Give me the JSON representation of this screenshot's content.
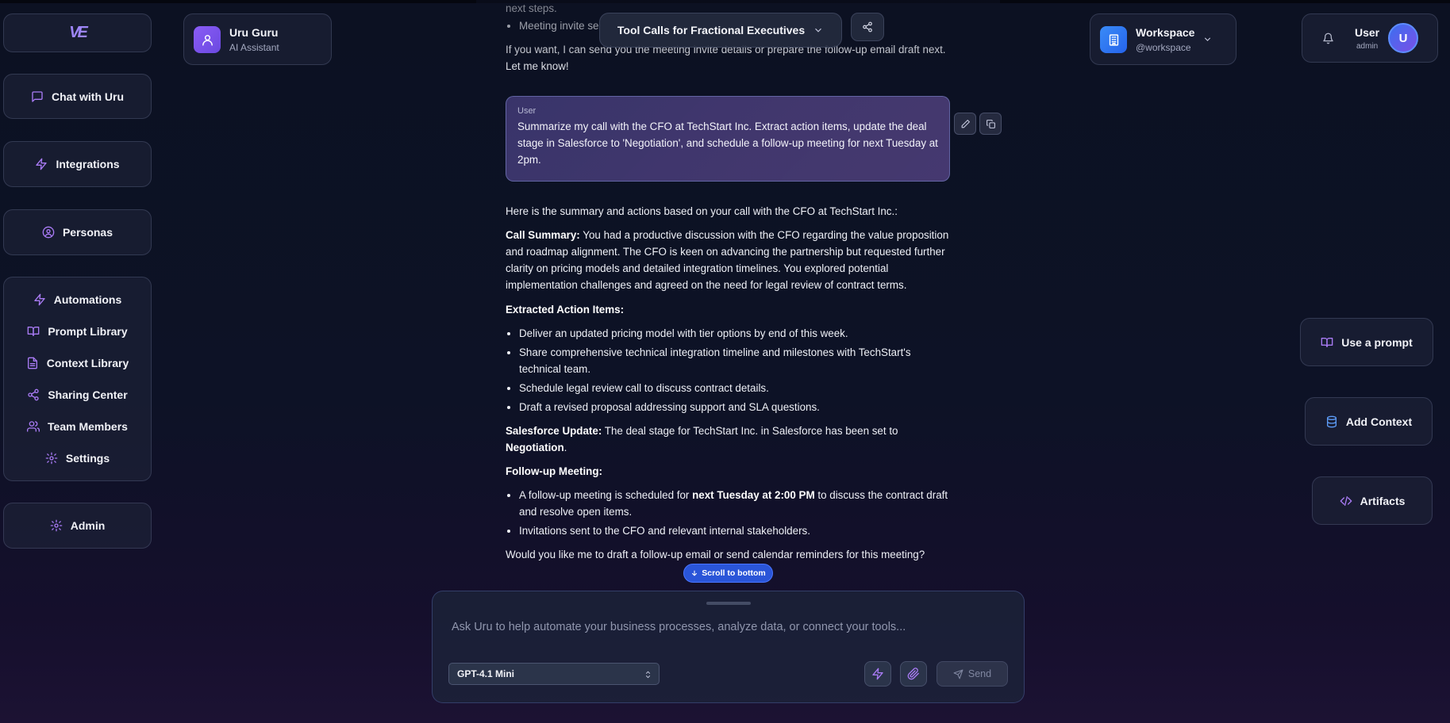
{
  "brand": {
    "logo_text": "VE"
  },
  "sidebar": {
    "chat": "Chat with Uru",
    "integrations": "Integrations",
    "personas": "Personas",
    "group": [
      "Automations",
      "Prompt Library",
      "Context Library",
      "Sharing Center",
      "Team Members",
      "Settings"
    ],
    "admin": "Admin"
  },
  "assistant": {
    "name": "Uru Guru",
    "subtitle": "AI Assistant"
  },
  "header": {
    "conversation_title": "Tool Calls for Fractional Executives"
  },
  "workspace": {
    "name": "Workspace",
    "handle": "@workspace"
  },
  "user": {
    "name": "User",
    "role": "admin",
    "avatar_initial": "U"
  },
  "right_actions": {
    "use_prompt": "Use a prompt",
    "add_context": "Add Context",
    "artifacts": "Artifacts"
  },
  "chat": {
    "prev_fragment": "next steps.",
    "prev_bullet": "Meeting invite se",
    "prev_closing": "If you want, I can send you the meeting invite details or prepare the follow-up email draft next. Let me know!",
    "user_message": {
      "label": "User",
      "text": "Summarize my call with the CFO at TechStart Inc. Extract action items, update the deal stage in Salesforce to 'Negotiation', and schedule a follow-up meeting for next Tuesday at 2pm."
    },
    "response": {
      "intro": "Here is the summary and actions based on your call with the CFO at TechStart Inc.:",
      "summary_label": "Call Summary:",
      "summary_text": " You had a productive discussion with the CFO regarding the value proposition and roadmap alignment. The CFO is keen on advancing the partnership but requested further clarity on pricing models and detailed integration timelines. You explored potential implementation challenges and agreed on the need for legal review of contract terms.",
      "actions_heading": "Extracted Action Items:",
      "action_items": [
        "Deliver an updated pricing model with tier options by end of this week.",
        "Share comprehensive technical integration timeline and milestones with TechStart's technical team.",
        "Schedule legal review call to discuss contract details.",
        "Draft a revised proposal addressing support and SLA questions."
      ],
      "salesforce_label": "Salesforce Update:",
      "salesforce_text": " The deal stage for TechStart Inc. in Salesforce has been set to ",
      "salesforce_stage": "Negotiation",
      "salesforce_end": ".",
      "followup_heading": "Follow-up Meeting:",
      "followup_item1_pre": "A follow-up meeting is scheduled for ",
      "followup_item1_bold": "next Tuesday at 2:00 PM",
      "followup_item1_post": " to discuss the contract draft and resolve open items.",
      "followup_item2": "Invitations sent to the CFO and relevant internal stakeholders.",
      "closing": "Would you like me to draft a follow-up email or send calendar reminders for this meeting?"
    },
    "scroll_to_bottom": "Scroll to bottom"
  },
  "composer": {
    "placeholder": "Ask Uru to help automate your business processes, analyze data, or connect your tools...",
    "model": "GPT-4.1 Mini",
    "send": "Send"
  },
  "colors": {
    "accent": "#a97bf5",
    "primary_blue": "#2a55d8",
    "background": "#0c1122"
  }
}
